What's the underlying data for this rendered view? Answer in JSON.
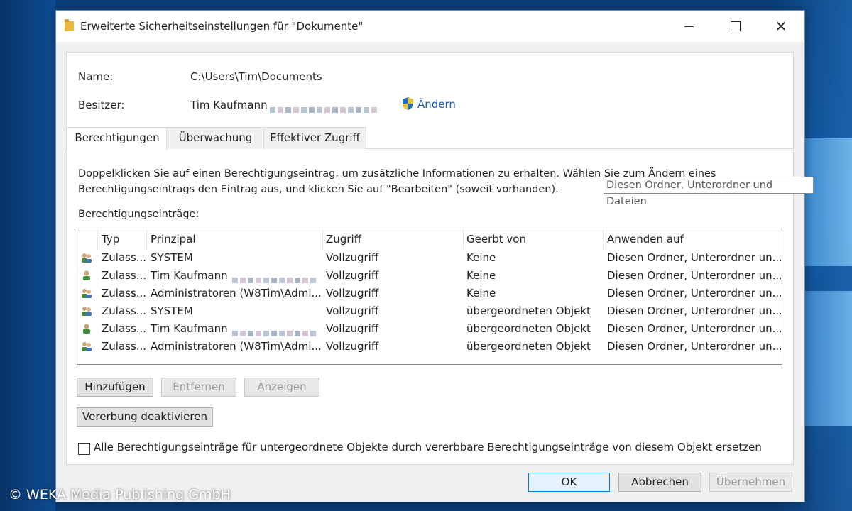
{
  "window": {
    "title": "Erweiterte Sicherheitseinstellungen für \"Dokumente\""
  },
  "info": {
    "name_label": "Name:",
    "name_value": "C:\\Users\\Tim\\Documents",
    "owner_label": "Besitzer:",
    "owner_value": "Tim Kaufmann",
    "change_link": "Ändern"
  },
  "tabs": [
    {
      "label": "Berechtigungen",
      "active": true
    },
    {
      "label": "Überwachung",
      "active": false
    },
    {
      "label": "Effektiver Zugriff",
      "active": false
    }
  ],
  "description_line1": "Doppelklicken Sie auf einen Berechtigungseintrag, um zusätzliche Informationen zu erhalten. Wählen Sie zum Ändern eines",
  "description_line2": "Berechtigungseintrags den Eintrag aus, und klicken Sie auf \"Bearbeiten\" (soweit vorhanden).",
  "entries_label": "Berechtigungseinträge:",
  "columns": [
    "Typ",
    "Prinzipal",
    "Zugriff",
    "Geerbt von",
    "Anwenden auf"
  ],
  "rows": [
    {
      "icon": "group-icon",
      "type": "Zulass...",
      "principal": "SYSTEM",
      "access": "Vollzugriff",
      "inherited": "Keine",
      "apply": "Diesen Ordner, Unterordner un..."
    },
    {
      "icon": "user-icon",
      "type": "Zulass...",
      "principal": "Tim Kaufmann",
      "access": "Vollzugriff",
      "inherited": "Keine",
      "apply": "Diesen Ordner, Unterordner un..."
    },
    {
      "icon": "group-icon",
      "type": "Zulass...",
      "principal": "Administratoren (W8Tim\\Admi...",
      "access": "Vollzugriff",
      "inherited": "Keine",
      "apply": "Diesen Ordner, Unterordner un..."
    },
    {
      "icon": "group-icon",
      "type": "Zulass...",
      "principal": "SYSTEM",
      "access": "Vollzugriff",
      "inherited": "übergeordneten Objekt",
      "apply": "Diesen Ordner, Unterordner un..."
    },
    {
      "icon": "user-icon",
      "type": "Zulass...",
      "principal": "Tim Kaufmann",
      "access": "Vollzugriff",
      "inherited": "übergeordneten Objekt",
      "apply": "Diesen Ordner, Unterordner un..."
    },
    {
      "icon": "group-icon",
      "type": "Zulass...",
      "principal": "Administratoren (W8Tim\\Admi...",
      "access": "Vollzugriff",
      "inherited": "übergeordneten Objekt",
      "apply": "Diesen Ordner, Unterordner un..."
    }
  ],
  "tooltip": "Diesen Ordner, Unterordner und Dateien",
  "buttons": {
    "add": "Hinzufügen",
    "remove": "Entfernen",
    "view": "Anzeigen",
    "disable_inheritance": "Vererbung deaktivieren",
    "ok": "OK",
    "cancel": "Abbrechen",
    "apply": "Übernehmen"
  },
  "replace_checkbox_label": "Alle Berechtigungseinträge für untergeordnete Objekte durch vererbbare Berechtigungseinträge von diesem Objekt ersetzen",
  "copyright": "© WEKA Media Publishing GmbH",
  "colors": {
    "accent": "#0078d7",
    "link": "#1a5ea8",
    "desktop": "#0b4a8e"
  }
}
